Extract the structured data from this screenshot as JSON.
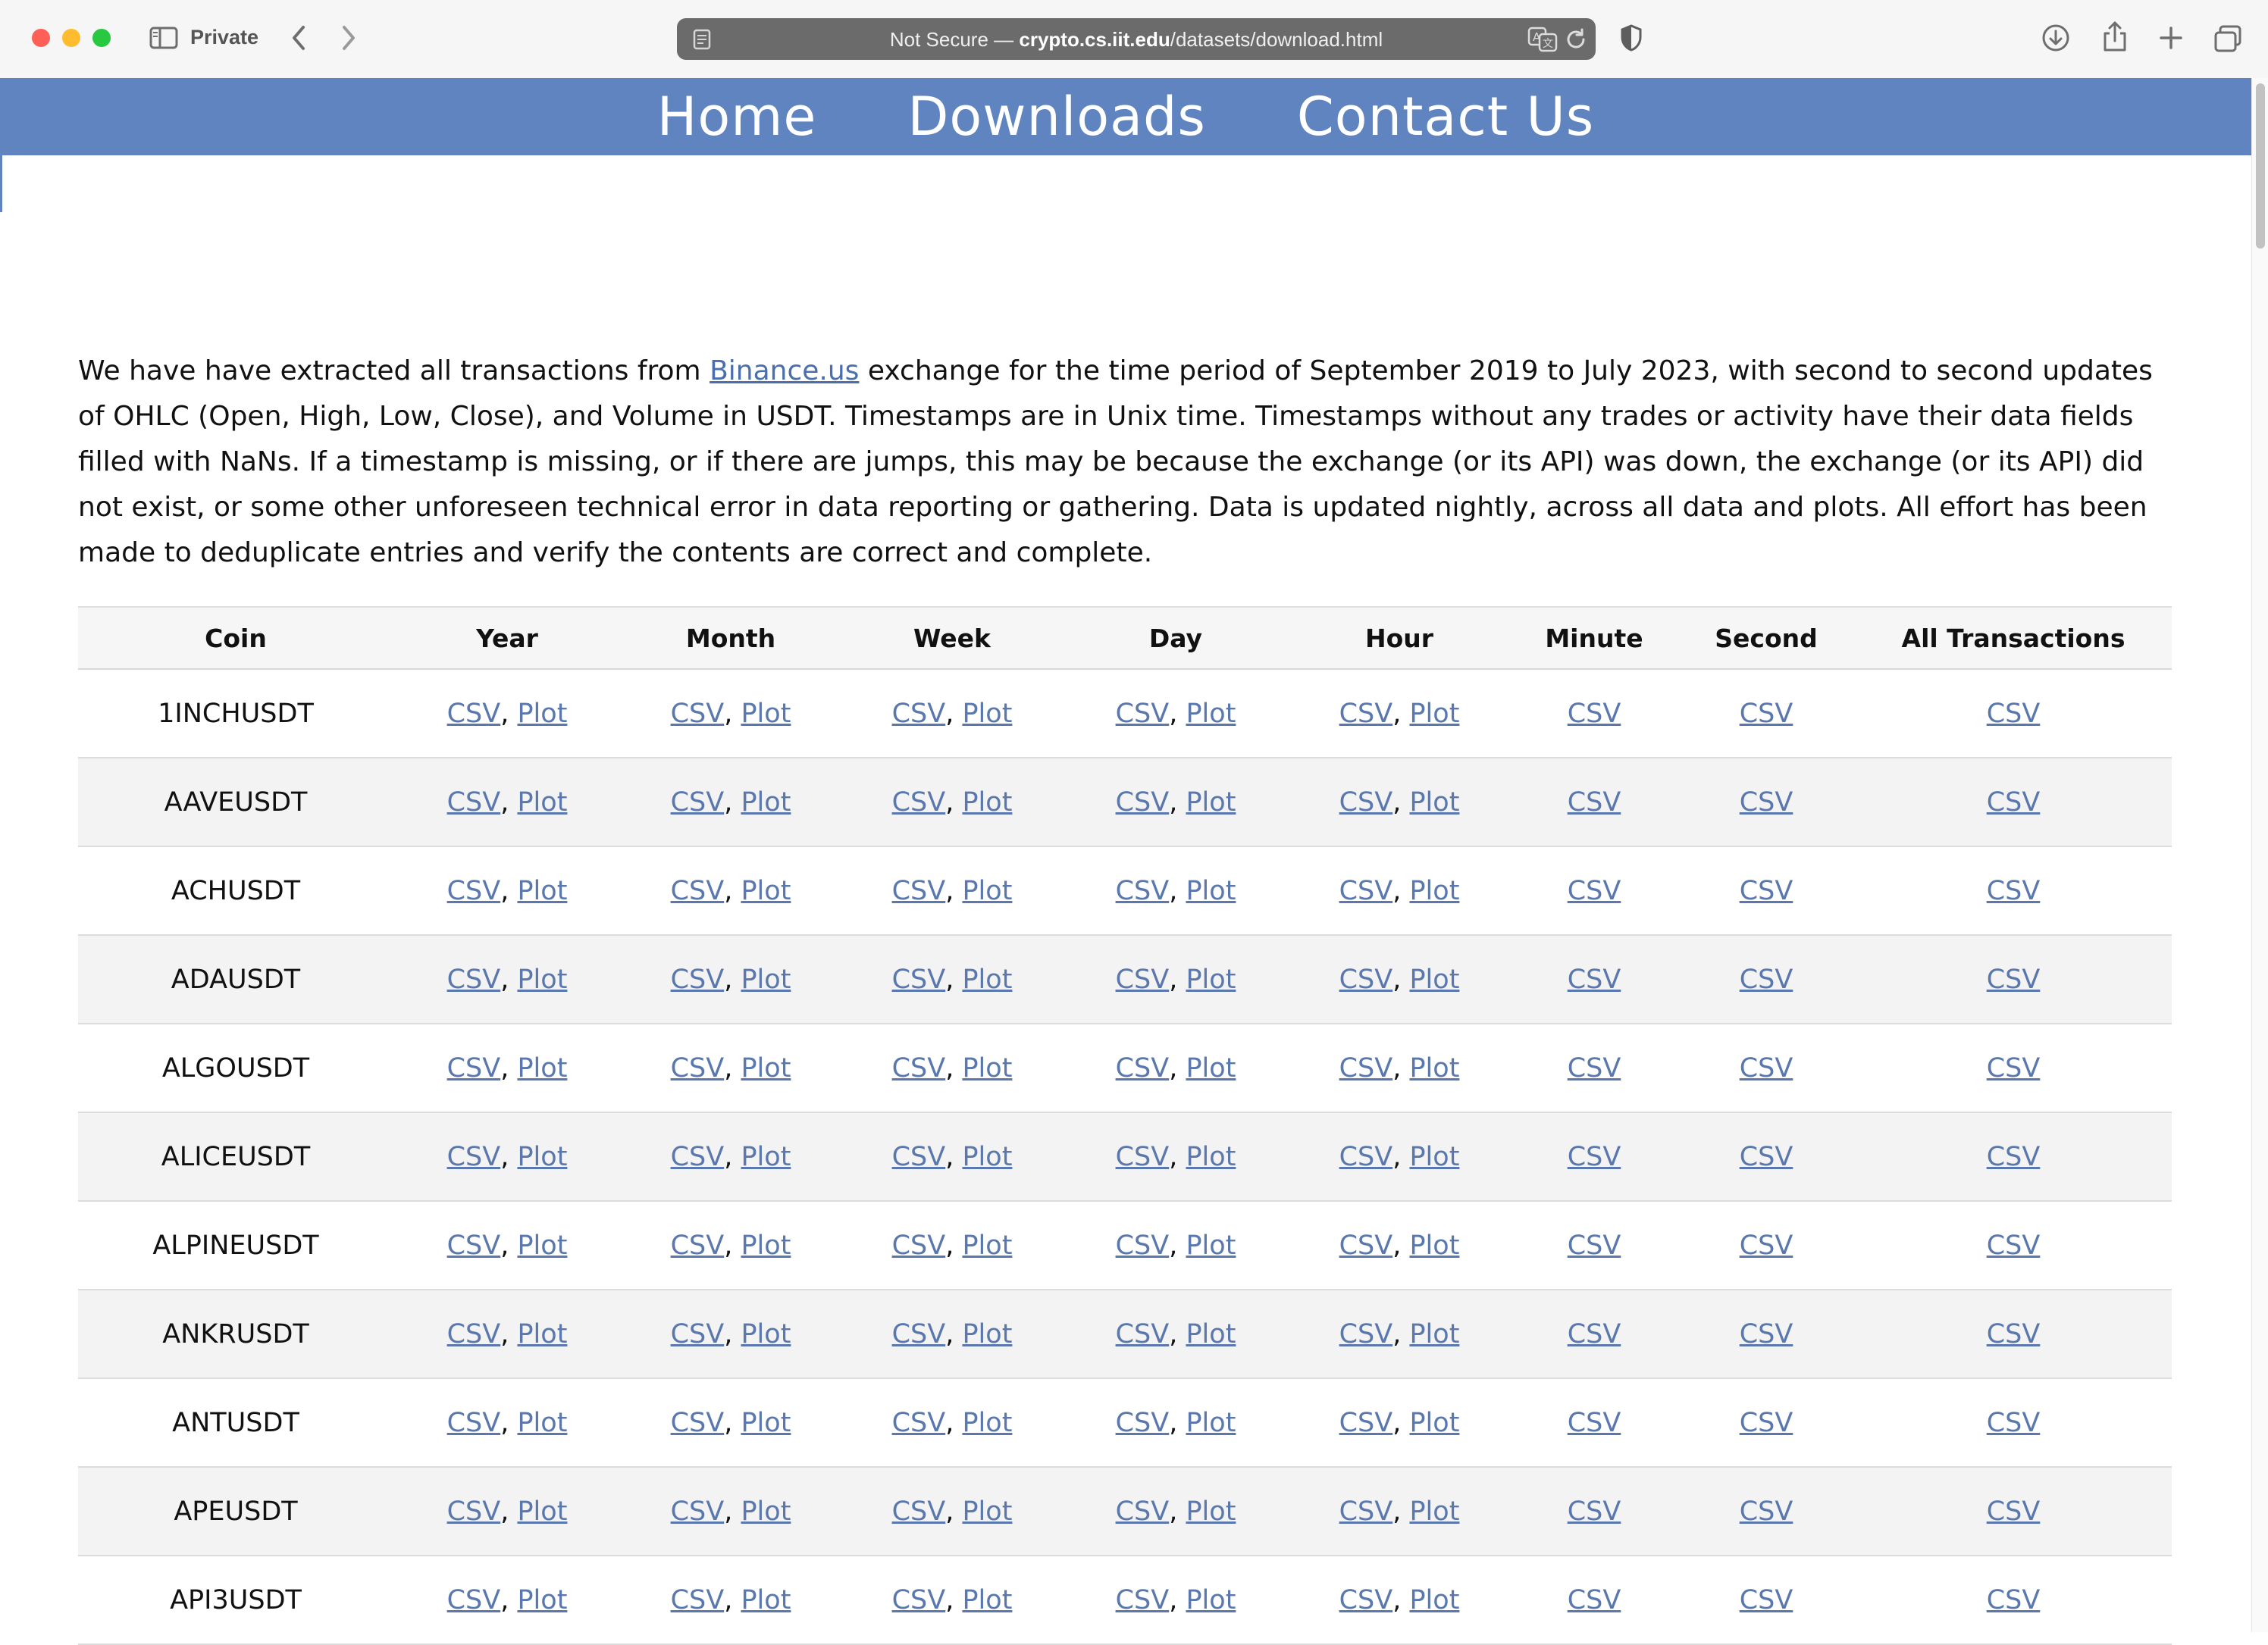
{
  "browser": {
    "private_label": "Private",
    "url_prefix": "Not Secure — ",
    "url_host": "crypto.cs.iit.edu",
    "url_path": "/datasets/download.html"
  },
  "nav": {
    "home": "Home",
    "downloads": "Downloads",
    "contact": "Contact Us"
  },
  "intro": {
    "before_link": "We have have extracted all transactions from ",
    "link_text": "Binance.us",
    "after_link": " exchange for the time period of September 2019 to July 2023, with second to second updates of OHLC (Open, High, Low, Close), and Volume in USDT. Timestamps are in Unix time. Timestamps without any trades or activity have their data fields filled with NaNs. If a timestamp is missing, or if there are jumps, this may be because the exchange (or its API) was down, the exchange (or its API) did not exist, or some other unforeseen technical error in data reporting or gathering. Data is updated nightly, across all data and plots. All effort has been made to deduplicate entries and verify the contents are correct and complete."
  },
  "table": {
    "headers": [
      "Coin",
      "Year",
      "Month",
      "Week",
      "Day",
      "Hour",
      "Minute",
      "Second",
      "All Transactions"
    ],
    "csv_label": "CSV",
    "plot_label": "Plot",
    "separator": ", ",
    "coins": [
      "1INCHUSDT",
      "AAVEUSDT",
      "ACHUSDT",
      "ADAUSDT",
      "ALGOUSDT",
      "ALICEUSDT",
      "ALPINEUSDT",
      "ANKRUSDT",
      "ANTUSDT",
      "APEUSDT",
      "API3USDT"
    ]
  }
}
